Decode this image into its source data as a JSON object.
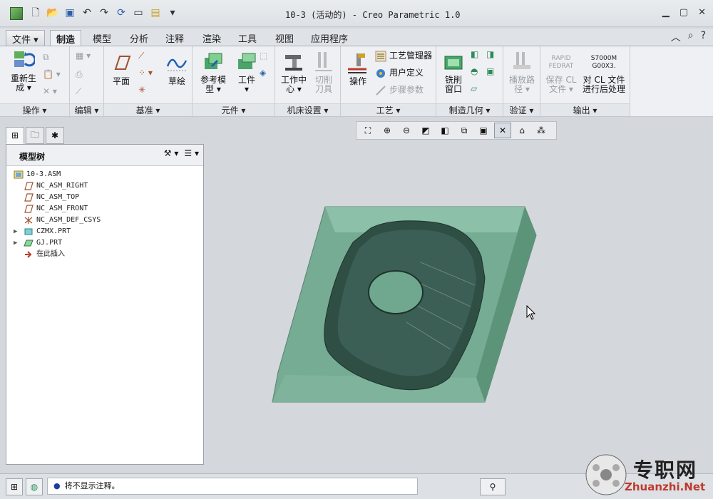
{
  "window": {
    "title": "10-3 (活动的) - Creo Parametric 1.0"
  },
  "quick_access": [
    "new-icon",
    "open-icon",
    "save-icon",
    "undo-icon",
    "redo-icon",
    "regenerate-icon",
    "windows-icon",
    "close-window-icon"
  ],
  "tabs": [
    {
      "label": "文件 ▾",
      "name": "tab-file"
    },
    {
      "label": "制造",
      "name": "tab-manufacturing",
      "active": true
    },
    {
      "label": "模型",
      "name": "tab-model"
    },
    {
      "label": "分析",
      "name": "tab-analysis"
    },
    {
      "label": "注释",
      "name": "tab-annotate"
    },
    {
      "label": "渲染",
      "name": "tab-render"
    },
    {
      "label": "工具",
      "name": "tab-tools"
    },
    {
      "label": "视图",
      "name": "tab-view"
    },
    {
      "label": "应用程序",
      "name": "tab-applications"
    }
  ],
  "ribbon": {
    "operations": {
      "label": "操作 ▾",
      "regenerate": "重新生\n成 ▾"
    },
    "edit": {
      "label": "编辑 ▾"
    },
    "datum": {
      "label": "基准 ▾",
      "plane": "平面",
      "sketch": "草绘"
    },
    "components": {
      "label": "元件 ▾",
      "reference_model": "参考模\n型 ▾",
      "workpiece": "工件\n▾"
    },
    "machine_setup": {
      "label": "机床设置 ▾",
      "work_center": "工作中\n心 ▾",
      "cutting_tools": "切削\n刀具"
    },
    "process": {
      "label": "工艺 ▾",
      "operation": "操作",
      "process_manager": "工艺管理器",
      "user_defined": "用户定义",
      "step_parameters": "步骤参数"
    },
    "mfg_geometry": {
      "label": "制造几何 ▾",
      "mill_window": "铣削\n窗口"
    },
    "validate": {
      "label": "验证 ▾",
      "play_path": "播放路\n径 ▾"
    },
    "output": {
      "label": "输出 ▾",
      "save_cl": "保存 CL\n文件 ▾",
      "rapid": "RAPID\nFEDRAT",
      "post_process": "对 CL 文件\n进行后处理",
      "s7000": "S7000M\nG00X3."
    }
  },
  "model_tree": {
    "title": "模型树",
    "items": [
      {
        "label": "10-3.ASM",
        "icon": "assembly-icon",
        "indent": 0,
        "expand": ""
      },
      {
        "label": "NC_ASM_RIGHT",
        "icon": "datum-plane-icon",
        "indent": 1,
        "expand": ""
      },
      {
        "label": "NC_ASM_TOP",
        "icon": "datum-plane-icon",
        "indent": 1,
        "expand": ""
      },
      {
        "label": "NC_ASM_FRONT",
        "icon": "datum-plane-icon",
        "indent": 1,
        "expand": ""
      },
      {
        "label": "NC_ASM_DEF_CSYS",
        "icon": "csys-icon",
        "indent": 1,
        "expand": ""
      },
      {
        "label": "CZMX.PRT",
        "icon": "part-icon",
        "indent": 1,
        "expand": "▶"
      },
      {
        "label": "GJ.PRT",
        "icon": "workpiece-icon",
        "indent": 1,
        "expand": "▶"
      },
      {
        "label": "在此插入",
        "icon": "insert-here-icon",
        "indent": 1,
        "expand": ""
      }
    ]
  },
  "status": {
    "message": "将不显示注释。"
  },
  "watermark": {
    "cn": "专职网",
    "en": "Zhuanzhi.Net"
  },
  "colors": {
    "workpiece": "#6fa88e",
    "part": "#2f4f45",
    "background": "#d4d7db"
  }
}
